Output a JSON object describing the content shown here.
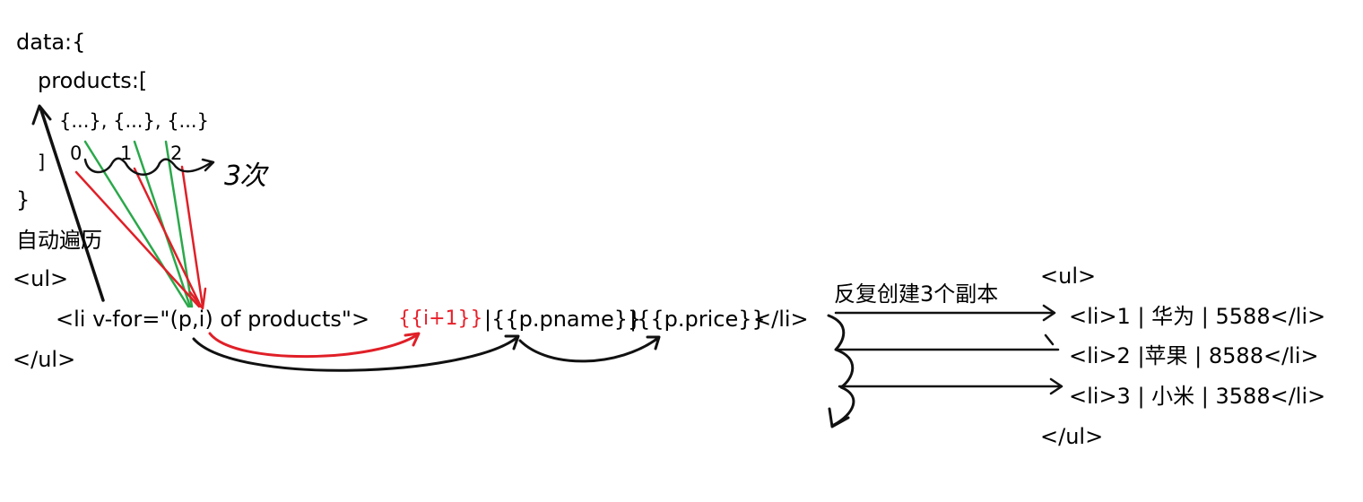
{
  "colors": {
    "text": "#000000",
    "highlight_text": "#e8212b",
    "arrow_black": "#111111",
    "arrow_red": "#e01f27",
    "arrow_green": "#2aa84a"
  },
  "data_block": {
    "open": "data:{",
    "products_open": "products:[",
    "items": "{...}, {...}, {...}",
    "index_0": "0",
    "index_1": "1",
    "index_2": "2",
    "array_close": "]",
    "object_close": "}",
    "count_note": "3次"
  },
  "auto_iterate_label": "自动遍历",
  "template": {
    "ul_open": "<ul>",
    "li_open": "<li v-for=\"(p,i) of products\">",
    "index_expr": "{{i+1}}",
    "name_expr": "|{{p.pname}}",
    "price_expr": "|{{p.price}}",
    "li_close": "</li>",
    "ul_close": "</ul>"
  },
  "copies_label": "反复创建3个副本",
  "output": {
    "ul_open": "<ul>",
    "items": [
      "<li>1 | 华为 | 5588</li>",
      "<li>2 |苹果 | 8588</li>",
      "<li>3 | 小米 | 3588</li>"
    ],
    "ul_close": "</ul>"
  }
}
